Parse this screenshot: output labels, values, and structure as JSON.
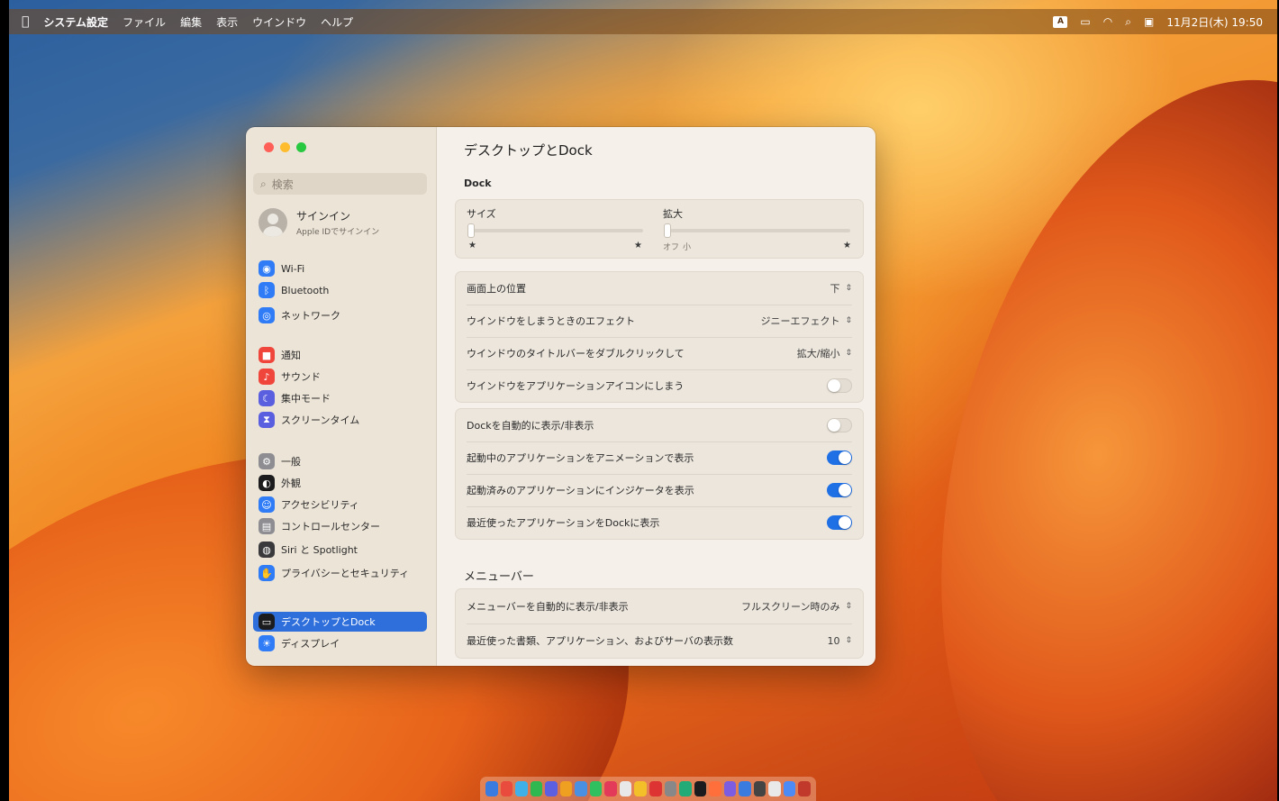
{
  "menubar": {
    "app_name": "システム設定",
    "items": [
      "ファイル",
      "編集",
      "表示",
      "ウインドウ",
      "ヘルプ"
    ],
    "status_box": "A",
    "datetime": "11月2日(木) 19:50"
  },
  "sidebar": {
    "search_placeholder": "検索",
    "profile": {
      "name": "サインイン",
      "subtitle": "Apple IDでサインイン"
    },
    "items": [
      {
        "label": "Wi-Fi",
        "icon": "wifi-icon",
        "color": "#2f7cf6",
        "glyph": "◉"
      },
      {
        "label": "Bluetooth",
        "icon": "bluetooth-icon",
        "color": "#2f7cf6",
        "glyph": "ᛒ"
      },
      {
        "label": "ネットワーク",
        "icon": "network-icon",
        "color": "#2f7cf6",
        "glyph": "◎"
      },
      {
        "label": "通知",
        "icon": "notifications-icon",
        "color": "#f0453a",
        "glyph": "■"
      },
      {
        "label": "サウンド",
        "icon": "sound-icon",
        "color": "#f0453a",
        "glyph": "♪"
      },
      {
        "label": "集中モード",
        "icon": "focus-icon",
        "color": "#5a5fe0",
        "glyph": "☾"
      },
      {
        "label": "スクリーンタイム",
        "icon": "screen-time-icon",
        "color": "#5a5fe0",
        "glyph": "⧗"
      },
      {
        "label": "一般",
        "icon": "general-icon",
        "color": "#8d8d92",
        "glyph": "⚙"
      },
      {
        "label": "外観",
        "icon": "appearance-icon",
        "color": "#1c1c1e",
        "glyph": "◐"
      },
      {
        "label": "アクセシビリティ",
        "icon": "accessibility-icon",
        "color": "#2f7cf6",
        "glyph": "☺"
      },
      {
        "label": "コントロールセンター",
        "icon": "control-center-icon",
        "color": "#8d8d92",
        "glyph": "▤"
      },
      {
        "label": "Siri と Spotlight",
        "icon": "siri-icon",
        "color": "#3a3a3c",
        "glyph": "◍"
      },
      {
        "label": "プライバシーとセキュリティ",
        "icon": "privacy-icon",
        "color": "#2f7cf6",
        "glyph": "✋"
      },
      {
        "label": "デスクトップとDock",
        "icon": "desktop-dock-icon",
        "color": "#1c1c1e",
        "glyph": "▭",
        "selected": true
      },
      {
        "label": "ディスプレイ",
        "icon": "displays-icon",
        "color": "#2f7cf6",
        "glyph": "☀"
      }
    ]
  },
  "content": {
    "title": "デスクトップとDock",
    "dock_section": "Dock",
    "size_label": "サイズ",
    "magnification_label": "拡大",
    "magnification_ticks": [
      "オフ",
      "小"
    ],
    "rows_group1": [
      {
        "label": "画面上の位置",
        "value": "下"
      },
      {
        "label": "ウインドウをしまうときのエフェクト",
        "value": "ジニーエフェクト"
      },
      {
        "label": "ウインドウのタイトルバーをダブルクリックして",
        "value": "拡大/縮小"
      },
      {
        "label": "ウインドウをアプリケーションアイコンにしまう",
        "toggle": false
      }
    ],
    "rows_group2": [
      {
        "label": "Dockを自動的に表示/非表示",
        "toggle": false
      },
      {
        "label": "起動中のアプリケーションをアニメーションで表示",
        "toggle": true
      },
      {
        "label": "起動済みのアプリケーションにインジケータを表示",
        "toggle": true
      },
      {
        "label": "最近使ったアプリケーションをDockに表示",
        "toggle": true
      }
    ],
    "menubar_section": "メニューバー",
    "rows_group3": [
      {
        "label": "メニューバーを自動的に表示/非表示",
        "value": "フルスクリーン時のみ"
      },
      {
        "label": "最近使った書類、アプリケーション、およびサーバの表示数",
        "value": "10"
      }
    ]
  },
  "dock": {
    "apps": [
      "#3a7be0",
      "#e94c3d",
      "#3fb0e8",
      "#2fb84f",
      "#5b5fe0",
      "#f0a020",
      "#4a90e2",
      "#30c060",
      "#e33a5a",
      "#e8e8e8",
      "#f4c02a",
      "#d33",
      "#888",
      "#2a7",
      "#1c1c1e",
      "#ff6f3c",
      "#7c5ce0",
      "#3a7be0",
      "#444",
      "#e9e9e9",
      "#4c8bf5",
      "#c0392b"
    ]
  },
  "colors": {
    "accent": "#2f6fdc",
    "toggle_on": "#1f6fe5"
  }
}
